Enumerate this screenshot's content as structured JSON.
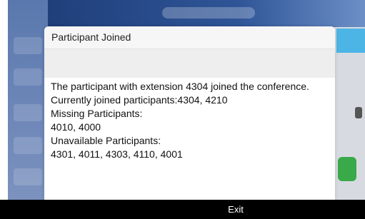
{
  "dialog": {
    "title": "Participant Joined",
    "lines": [
      "The participant with extension 4304 joined the conference.",
      "Currently joined participants:4304, 4210",
      "Missing Participants:",
      "4010, 4000",
      "Unavailable Participants:",
      "4301, 4011, 4303, 4110, 4001"
    ]
  },
  "bottom_bar": {
    "exit_label": "Exit"
  },
  "colors": {
    "bottom_bar": "#000000",
    "dialog_background": "#ffffff",
    "background_app_sidebar": "#6b85b7",
    "background_app_topbar": "#2f5597"
  }
}
